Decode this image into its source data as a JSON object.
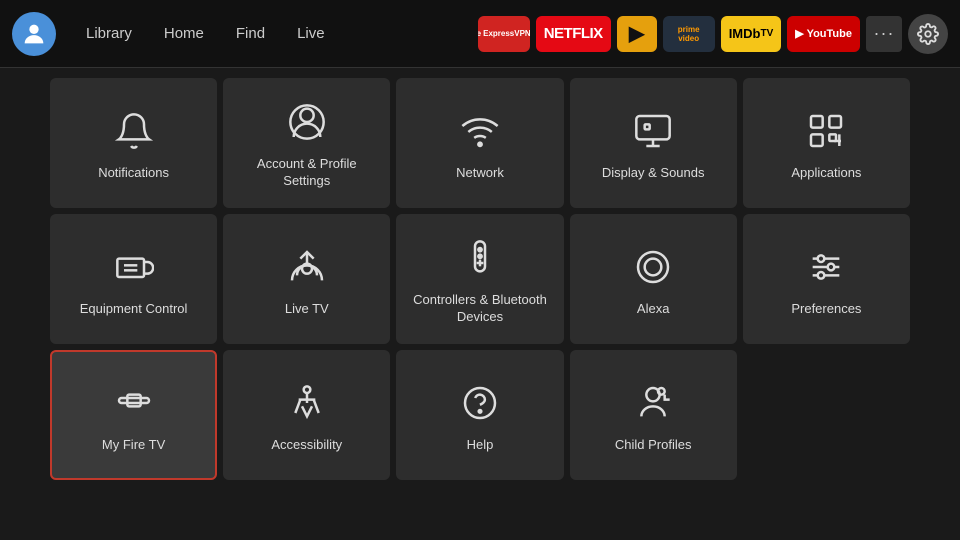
{
  "header": {
    "nav": {
      "library": "Library",
      "home": "Home",
      "find": "Find",
      "live": "Live"
    },
    "apps": [
      {
        "id": "expressvpn",
        "label": "ExpressVPN"
      },
      {
        "id": "netflix",
        "label": "NETFLIX"
      },
      {
        "id": "plex",
        "label": "▶"
      },
      {
        "id": "prime",
        "label": "prime video"
      },
      {
        "id": "imdb",
        "label": "IMDb TV"
      },
      {
        "id": "youtube",
        "label": "▶ YouTube"
      }
    ],
    "more_label": "•••",
    "settings_label": "⚙"
  },
  "grid": {
    "rows": [
      [
        {
          "id": "notifications",
          "label": "Notifications",
          "icon": "bell"
        },
        {
          "id": "account-profile",
          "label": "Account & Profile\nSettings",
          "icon": "person-circle"
        },
        {
          "id": "network",
          "label": "Network",
          "icon": "wifi"
        },
        {
          "id": "display-sounds",
          "label": "Display & Sounds",
          "icon": "display"
        },
        {
          "id": "applications",
          "label": "Applications",
          "icon": "apps-grid"
        }
      ],
      [
        {
          "id": "equipment-control",
          "label": "Equipment Control",
          "icon": "tv-remote"
        },
        {
          "id": "live-tv",
          "label": "Live TV",
          "icon": "antenna"
        },
        {
          "id": "controllers-bluetooth",
          "label": "Controllers & Bluetooth Devices",
          "icon": "remote"
        },
        {
          "id": "alexa",
          "label": "Alexa",
          "icon": "alexa"
        },
        {
          "id": "preferences",
          "label": "Preferences",
          "icon": "sliders"
        }
      ],
      [
        {
          "id": "my-fire-tv",
          "label": "My Fire TV",
          "icon": "firetv",
          "selected": true
        },
        {
          "id": "accessibility",
          "label": "Accessibility",
          "icon": "accessibility"
        },
        {
          "id": "help",
          "label": "Help",
          "icon": "question"
        },
        {
          "id": "child-profiles",
          "label": "Child Profiles",
          "icon": "child-profile"
        },
        null
      ]
    ]
  }
}
